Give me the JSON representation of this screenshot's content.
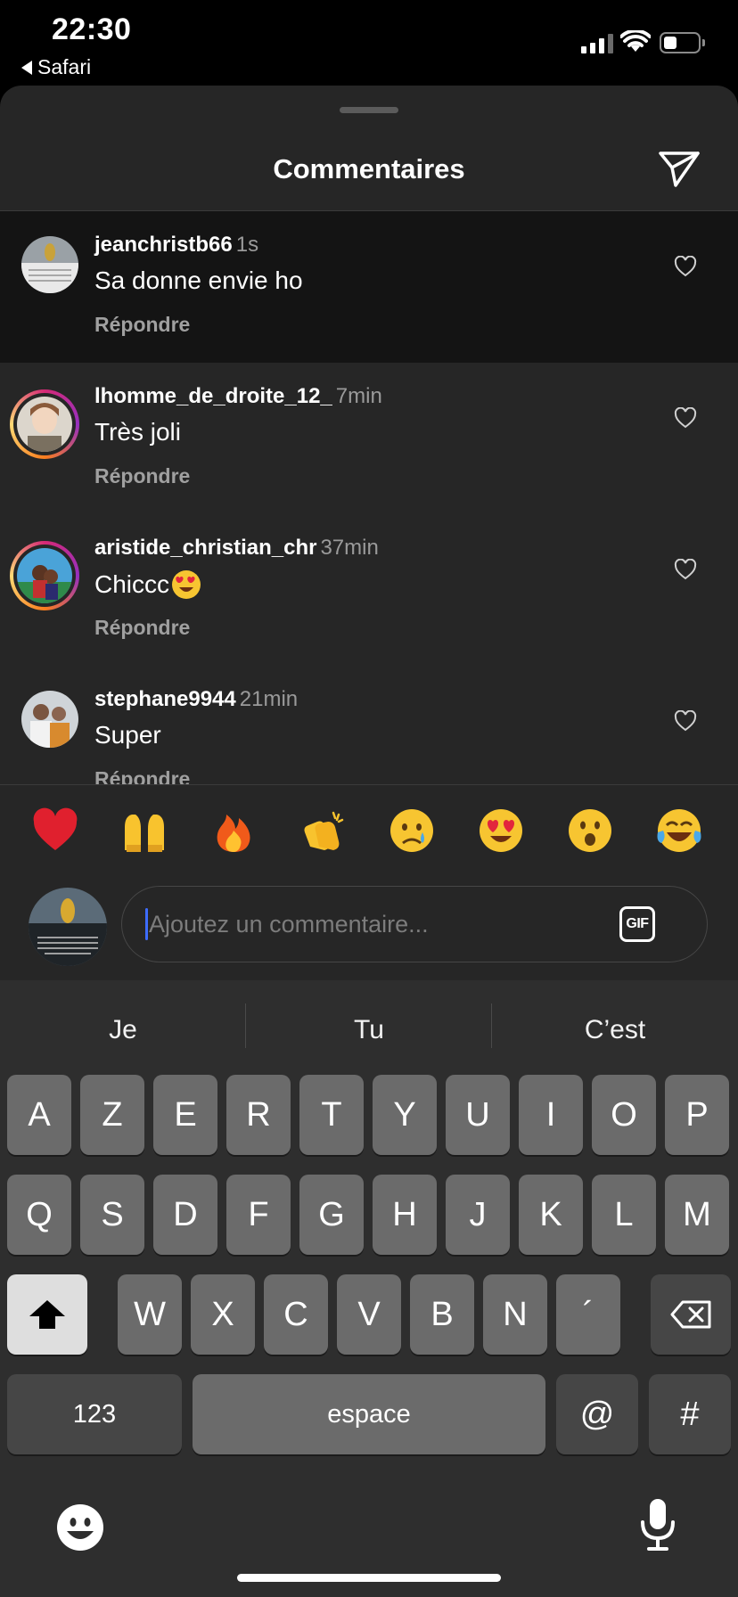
{
  "status_bar": {
    "time": "22:30",
    "back_label": "Safari"
  },
  "sheet": {
    "title": "Commentaires"
  },
  "comments": [
    {
      "user": "jeanchristb66",
      "time": "1s",
      "text": "Sa donne envie ho",
      "reply": "Répondre"
    },
    {
      "user": "lhomme_de_droite_12_",
      "time": "7min",
      "text": "Très joli",
      "reply": "Répondre"
    },
    {
      "user": "aristide_christian_chr",
      "time": "37min",
      "text": "Chiccc",
      "emoji": "heart-eyes-emoji",
      "reply": "Répondre"
    },
    {
      "user": "stephane9944",
      "time": "21min",
      "text": "Super",
      "reply": "Répondre"
    }
  ],
  "emoji_reactions": [
    "red-heart-emoji",
    "raising-hands-emoji",
    "fire-emoji",
    "clapping-hands-emoji",
    "crying-face-emoji",
    "heart-eyes-emoji",
    "astonished-face-emoji",
    "tears-of-joy-emoji"
  ],
  "composer": {
    "placeholder": "Ajoutez un commentaire...",
    "gif_label": "GIF"
  },
  "keyboard": {
    "predictions": [
      "Je",
      "Tu",
      "C’est"
    ],
    "row1": [
      "A",
      "Z",
      "E",
      "R",
      "T",
      "Y",
      "U",
      "I",
      "O",
      "P"
    ],
    "row2": [
      "Q",
      "S",
      "D",
      "F",
      "G",
      "H",
      "J",
      "K",
      "L",
      "M"
    ],
    "row3": [
      "W",
      "X",
      "C",
      "V",
      "B",
      "N",
      "´"
    ],
    "numbers_label": "123",
    "space_label": "espace",
    "at_label": "@",
    "hash_label": "#"
  },
  "colors": {
    "sheet_bg": "#262626",
    "highlight_bg": "#141414",
    "keyboard_bg": "#2e2e2e",
    "key_bg": "#6b6b6b",
    "cursor": "#3d6cff"
  }
}
